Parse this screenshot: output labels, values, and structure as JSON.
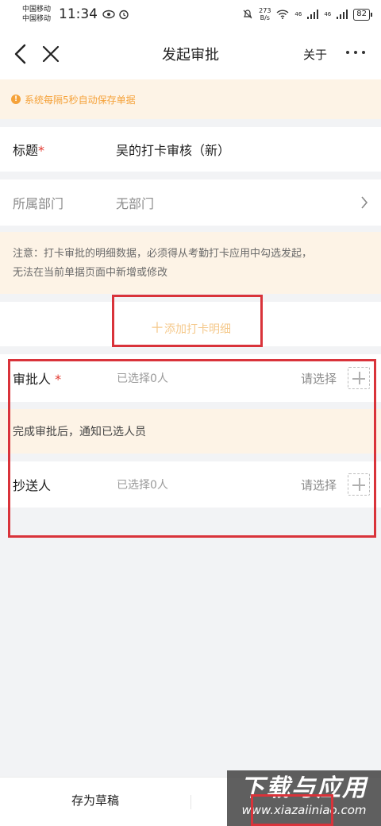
{
  "status_bar": {
    "carrier_1": "中国移动",
    "carrier_2": "中国移动",
    "time": "11:34",
    "speed_value": "273",
    "speed_unit": "B/s",
    "signal_1": "46",
    "signal_2": "46",
    "battery": "82"
  },
  "nav": {
    "title": "发起审批",
    "about_label": "关于"
  },
  "autosave_notice": "系统每隔5秒自动保存单据",
  "form": {
    "title_label": "标题",
    "required_mark": "*",
    "title_value": "吴的打卡审核（新）",
    "dept_label": "所属部门",
    "dept_value": "无部门"
  },
  "punch_notice": {
    "line1": "注意：打卡审批的明细数据，必须得从考勤打卡应用中勾选发起，",
    "line2": "无法在当前单据页面中新增或修改"
  },
  "add_detail": {
    "icon": "plus-icon",
    "label": "添加打卡明细"
  },
  "approver": {
    "label": "审批人",
    "required_mark": "*",
    "count_text": "已选择0人",
    "select_text": "请选择"
  },
  "notify_hint": "完成审批后，通知已选人员",
  "copy_to": {
    "label": "抄送人",
    "count_text": "已选择0人",
    "select_text": "请选择"
  },
  "bottom": {
    "draft_label": "存为草稿"
  },
  "watermark": {
    "main": "下载与应用",
    "sub": "www.xiazaiiniao.com"
  },
  "colors": {
    "accent_orange": "#f5a23a",
    "notice_bg": "#fdf3e6",
    "required_red": "#e3372e",
    "highlight_red": "#d9333a"
  }
}
